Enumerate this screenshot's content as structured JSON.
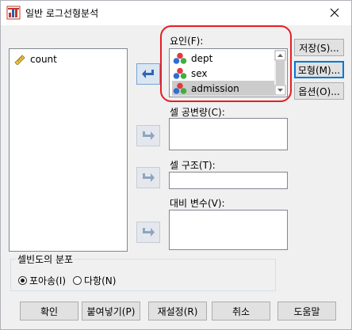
{
  "window": {
    "title": "일반 로그선형분석"
  },
  "source_list": {
    "items": [
      {
        "label": "count"
      }
    ]
  },
  "fields": {
    "factors": {
      "label": "요인(F):",
      "items": [
        {
          "label": "dept"
        },
        {
          "label": "sex"
        },
        {
          "label": "admission"
        }
      ]
    },
    "cell_covariates": {
      "label": "셀 공변량(C):"
    },
    "cell_structure": {
      "label": "셀 구조(T):"
    },
    "contrast_variables": {
      "label": "대비 변수(V):"
    }
  },
  "side_buttons": {
    "save": "저장(S)...",
    "model": "모형(M)...",
    "options": "옵션(O)..."
  },
  "distribution": {
    "title": "셀빈도의 분포",
    "poisson": "포아송(I)",
    "multinomial": "다항(N)",
    "selected": "poisson"
  },
  "bottom_buttons": {
    "ok": "확인",
    "paste": "붙여넣기(P)",
    "reset": "재설정(R)",
    "cancel": "취소",
    "help": "도움말"
  },
  "colors": {
    "accent": "#0078d7",
    "annotation": "#e51e25"
  }
}
